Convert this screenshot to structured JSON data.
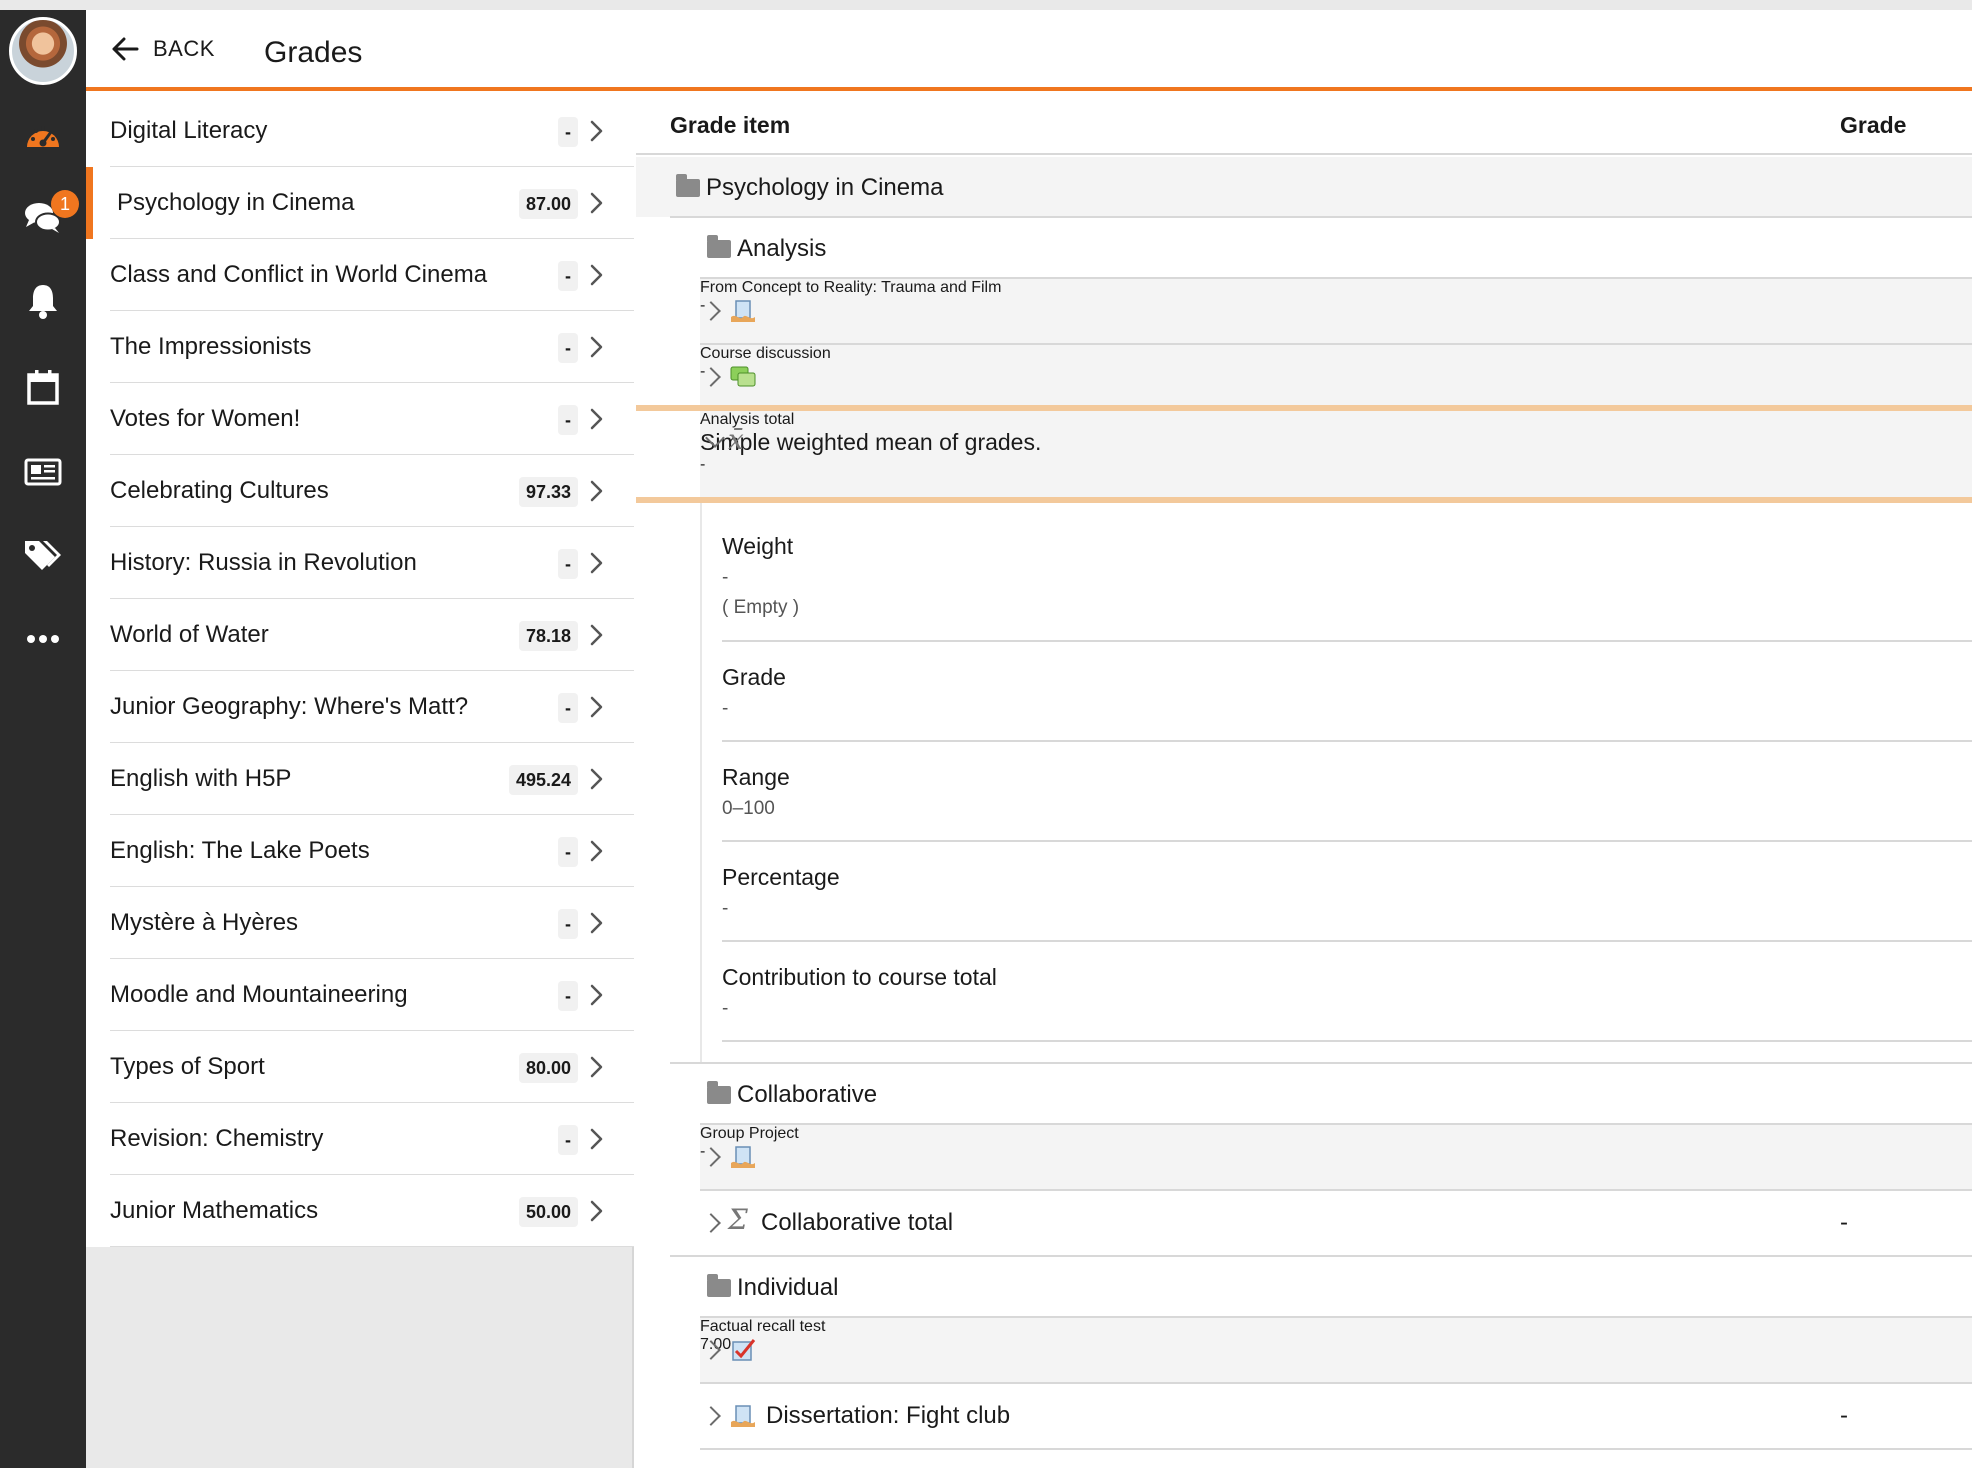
{
  "header": {
    "back_label": "BACK",
    "title": "Grades"
  },
  "rail": {
    "items": [
      "avatar",
      "dashboard-icon",
      "messages-icon",
      "notifications-icon",
      "calendar-icon",
      "news-icon",
      "tags-icon",
      "more-icon"
    ],
    "messages_badge": "1",
    "accent_color": "#f0761f"
  },
  "courses": [
    {
      "name": "Digital Literacy",
      "grade": "-"
    },
    {
      "name": "Psychology in Cinema",
      "grade": "87.00",
      "active": true
    },
    {
      "name": "Class and Conflict in World Cinema",
      "grade": "-"
    },
    {
      "name": "The Impressionists",
      "grade": "-"
    },
    {
      "name": "Votes for Women!",
      "grade": "-"
    },
    {
      "name": "Celebrating Cultures",
      "grade": "97.33"
    },
    {
      "name": "History: Russia in Revolution",
      "grade": "-"
    },
    {
      "name": "World of Water",
      "grade": "78.18"
    },
    {
      "name": "Junior Geography: Where's Matt?",
      "grade": "-"
    },
    {
      "name": "English with H5P",
      "grade": "495.24"
    },
    {
      "name": "English: The Lake Poets",
      "grade": "-"
    },
    {
      "name": "Mystère à Hyères",
      "grade": "-"
    },
    {
      "name": "Moodle and Mountaineering",
      "grade": "-"
    },
    {
      "name": "Types of Sport",
      "grade": "80.00"
    },
    {
      "name": "Revision: Chemistry",
      "grade": "-"
    },
    {
      "name": "Junior Mathematics",
      "grade": "50.00"
    }
  ],
  "grades_table": {
    "col_item": "Grade item",
    "col_grade": "Grade",
    "course_category": "Psychology in Cinema",
    "analysis": {
      "category": "Analysis",
      "items": [
        {
          "name": "From Concept to Reality: Trauma and Film",
          "grade": "-"
        },
        {
          "name": "Course discussion",
          "grade": "-"
        }
      ],
      "total_name": "Analysis total",
      "total_desc": "Simple weighted mean of grades.",
      "total_grade": "-",
      "details": [
        {
          "label": "Weight",
          "value": "-",
          "extra": "( Empty )"
        },
        {
          "label": "Grade",
          "value": "-"
        },
        {
          "label": "Range",
          "value": "0–100"
        },
        {
          "label": "Percentage",
          "value": "-"
        },
        {
          "label": "Contribution to course total",
          "value": "-"
        }
      ]
    },
    "collaborative": {
      "category": "Collaborative",
      "items": [
        {
          "name": "Group Project",
          "grade": "-"
        },
        {
          "name": "Collaborative total",
          "grade": "-"
        }
      ]
    },
    "individual": {
      "category": "Individual",
      "items": [
        {
          "name": "Factual recall test",
          "grade": "7.00"
        },
        {
          "name": "Dissertation: Fight club",
          "grade": "-"
        }
      ]
    }
  }
}
